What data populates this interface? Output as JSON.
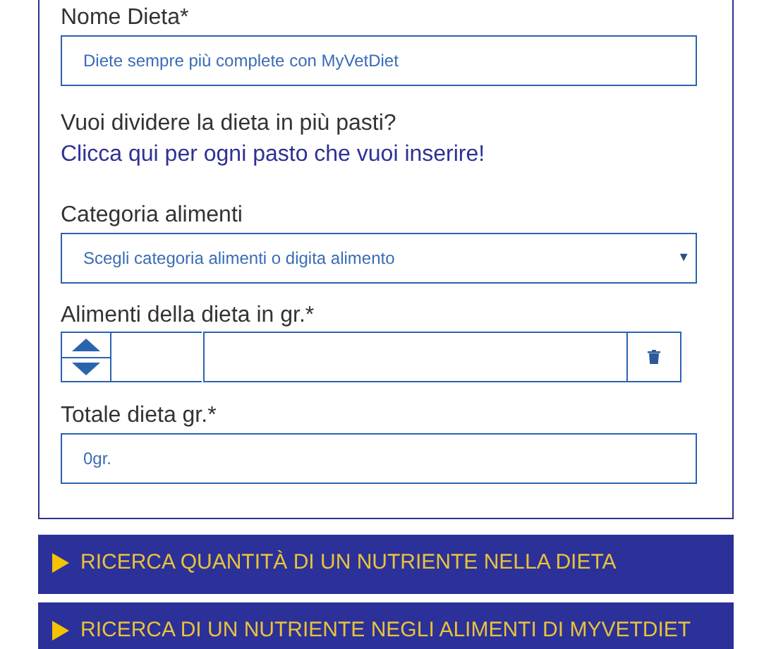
{
  "form": {
    "fields": [
      {
        "kind": "text",
        "label": "Nome Dieta*",
        "placeholder": "Diete sempre più complete con MyVetDiet"
      },
      {
        "kind": "note",
        "question": "Vuoi dividere la dieta in più pasti?",
        "link": "Clicca qui per ogni pasto che vuoi inserire!"
      },
      {
        "kind": "select",
        "label": "Categoria alimenti",
        "value": "Scegli categoria alimenti o digita alimento",
        "arrow": "▼"
      },
      {
        "kind": "food_row",
        "label": "Alimenti della dieta in gr.*"
      },
      {
        "kind": "text",
        "label": "Totale dieta gr.*",
        "placeholder": "0gr."
      }
    ]
  },
  "sections": [
    {
      "title": "RICERCA QUANTITÀ DI UN NUTRIENTE NELLA DIETA",
      "expanded": false
    },
    {
      "title": "RICERCA DI UN NUTRIENTE NEGLI ALIMENTI DI MYVETDIET",
      "expanded": false
    }
  ]
}
